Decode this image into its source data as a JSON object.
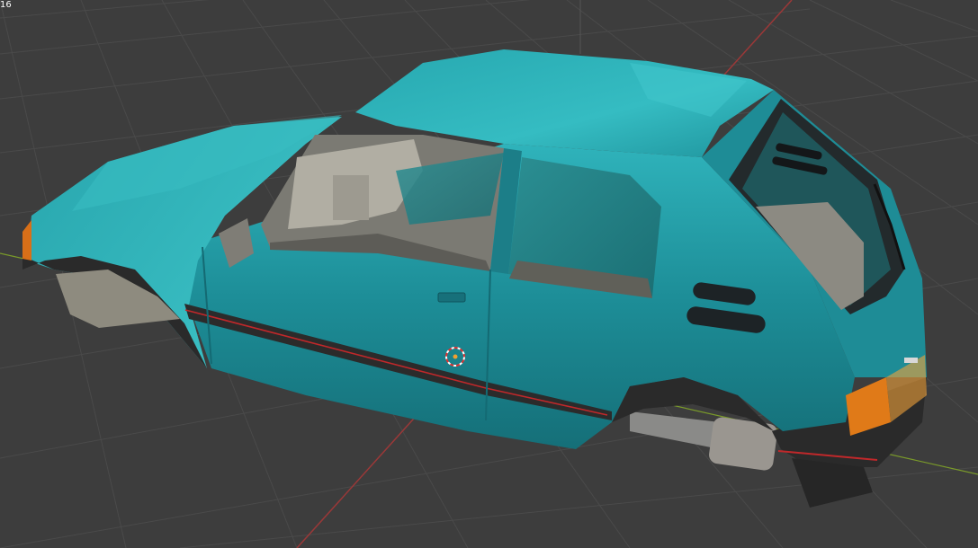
{
  "viewport": {
    "corner_text": "16",
    "background_color": "#3d3d3d",
    "grid_color": "#494949",
    "x_axis_color": "#a03a3a",
    "y_axis_color": "#7a9a2a",
    "body_color": "#1e8f9a",
    "interior_color": "#8c8a82",
    "trim_color": "#2c2c2c",
    "stripe_color": "#c0282a",
    "tail_light_color": "#e07a18",
    "cursor_icon": "3d-cursor-icon",
    "object": "car-body-model"
  }
}
